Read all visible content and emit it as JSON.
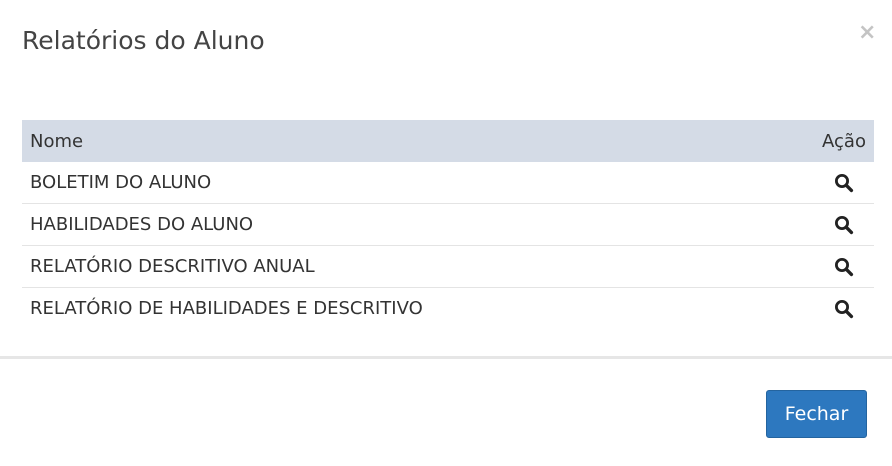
{
  "modal": {
    "title": "Relatórios do Aluno",
    "close_label": "×"
  },
  "table": {
    "headers": {
      "name": "Nome",
      "action": "Ação"
    },
    "rows": [
      {
        "name": "BOLETIM DO ALUNO",
        "action_icon": "search-icon"
      },
      {
        "name": "HABILIDADES DO ALUNO",
        "action_icon": "search-icon"
      },
      {
        "name": "RELATÓRIO DESCRITIVO ANUAL",
        "action_icon": "search-icon"
      },
      {
        "name": "RELATÓRIO DE HABILIDADES E DESCRITIVO",
        "action_icon": "search-icon"
      }
    ]
  },
  "footer": {
    "close_button_label": "Fechar"
  },
  "colors": {
    "header_row_bg": "#d4dbe6",
    "primary_button": "#2d78bf",
    "close_icon": "#c4c4c4"
  }
}
